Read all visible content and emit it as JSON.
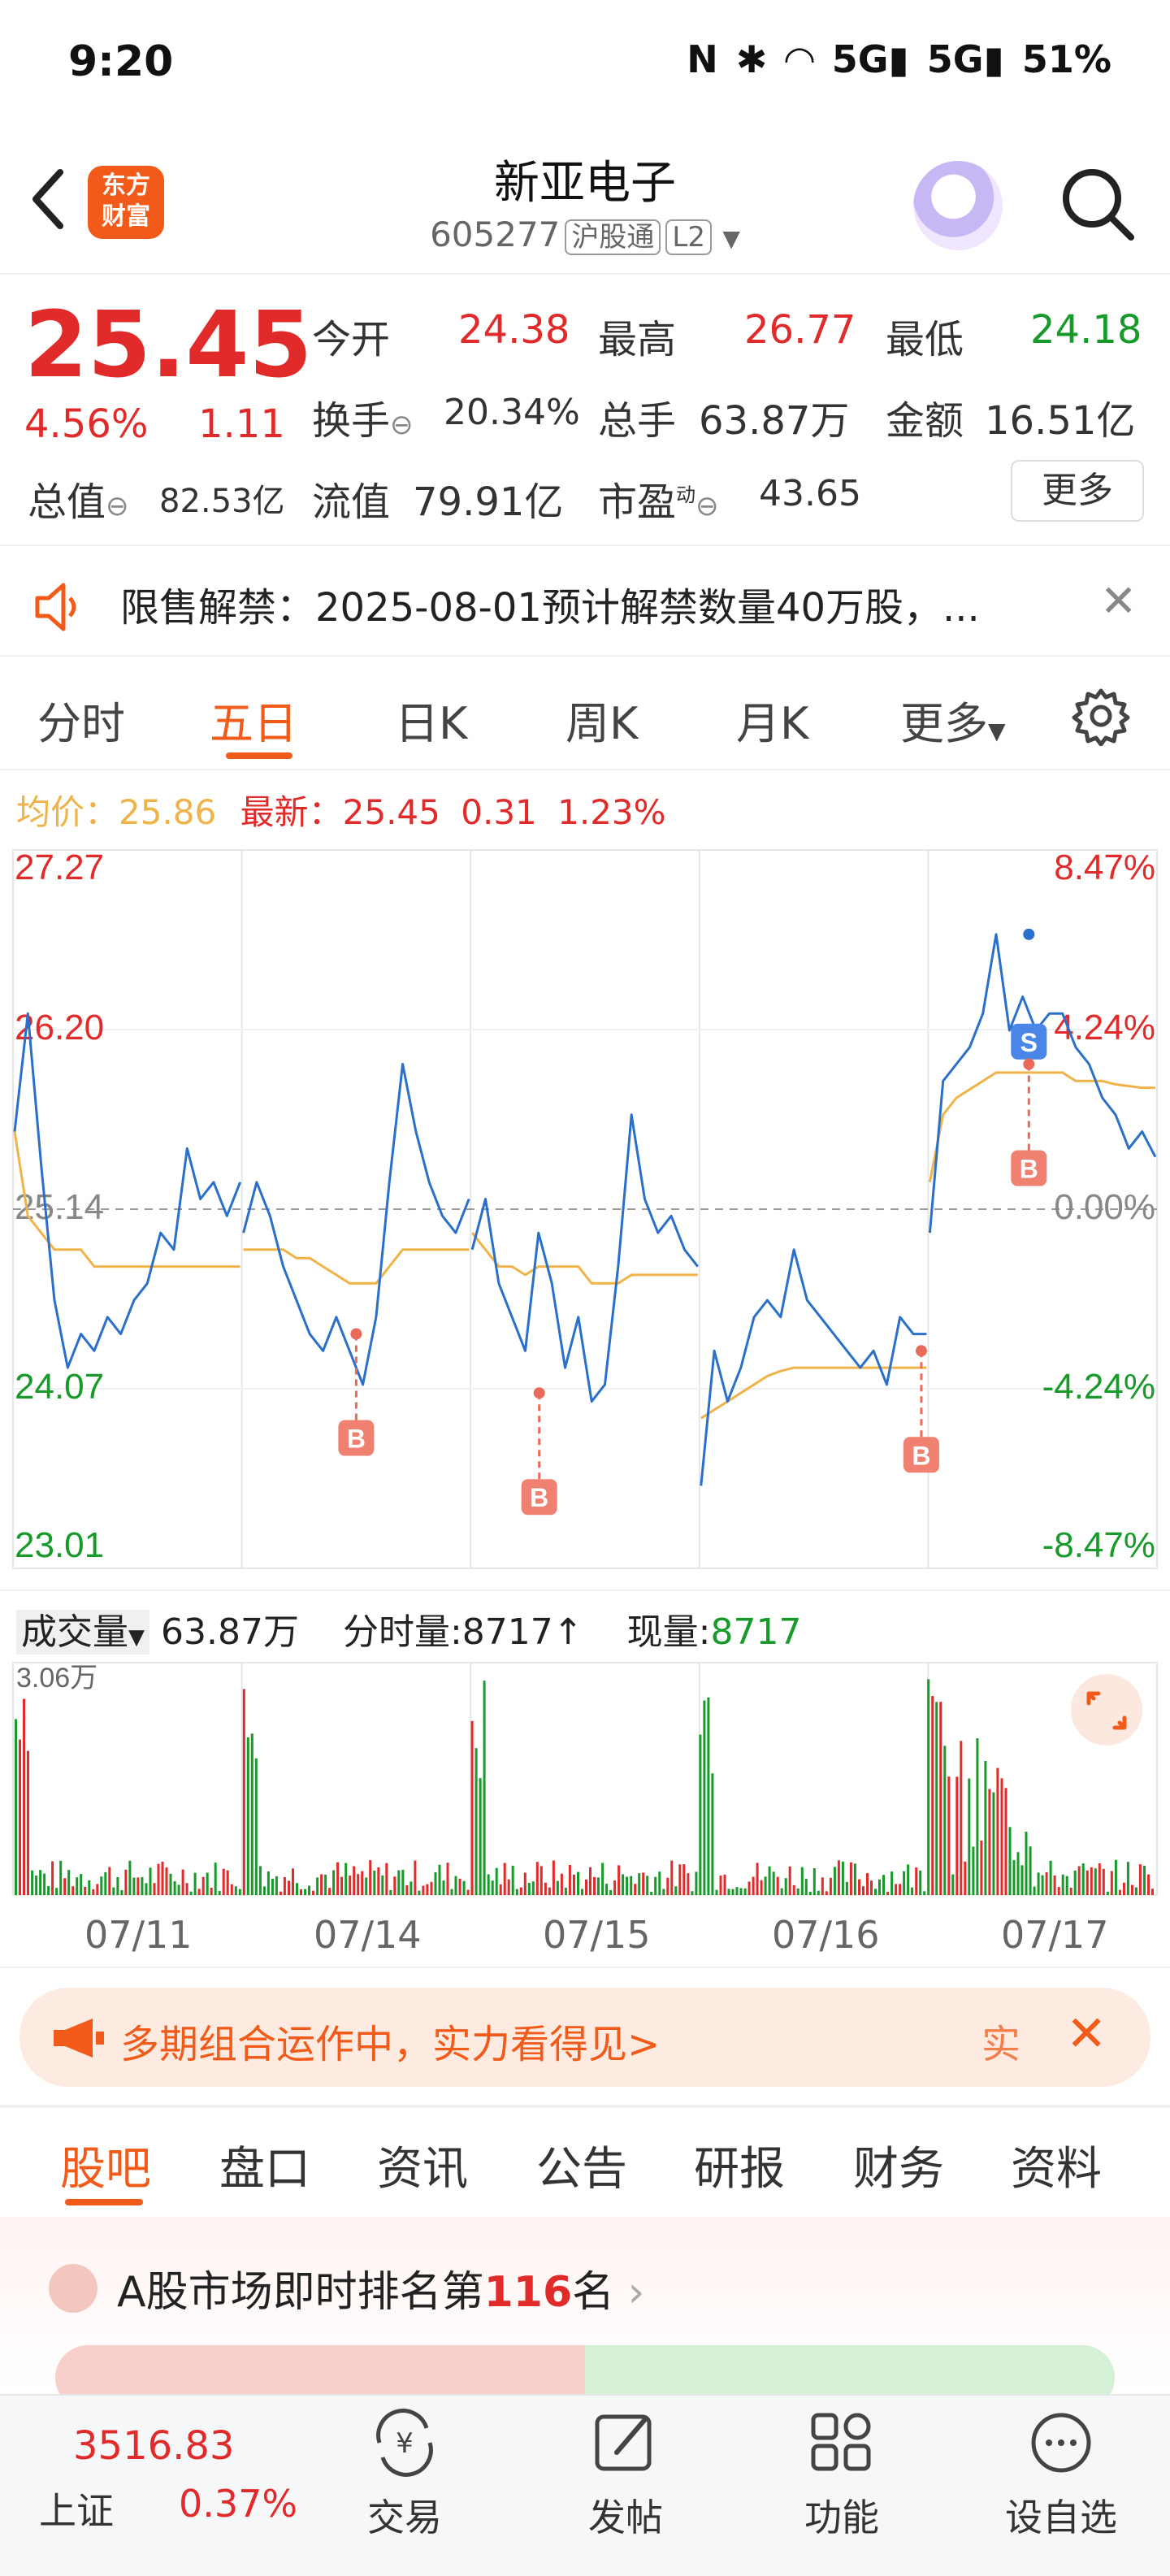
{
  "status": {
    "time": "9:20",
    "network": "5G",
    "network2": "5G",
    "battery": "51%"
  },
  "header": {
    "title": "新亚电子",
    "code": "605277",
    "market_tag": "沪股通",
    "level_tag": "L2",
    "logo_line1": "东方",
    "logo_line2": "财富"
  },
  "quote": {
    "price": "25.45",
    "change_pct": "4.56%",
    "change_abs": "1.11",
    "open_label": "今开",
    "open": "24.38",
    "high_label": "最高",
    "high": "26.77",
    "low_label": "最低",
    "low": "24.18",
    "turnover_label": "换手",
    "turnover": "20.34%",
    "volume_label": "总手",
    "volume": "63.87万",
    "amount_label": "金额",
    "amount": "16.51亿",
    "mktcap_label": "总值",
    "mktcap": "82.53亿",
    "float_label": "流值",
    "float_cap": "79.91亿",
    "pe_label": "市盈",
    "pe_sup": "动",
    "pe": "43.65",
    "more_label": "更多"
  },
  "notice": {
    "text": "限售解禁：2025-08-01预计解禁数量40万股，..."
  },
  "chart_tabs": [
    "分时",
    "五日",
    "日K",
    "周K",
    "月K",
    "更多"
  ],
  "chart_tabs_active": 1,
  "legend": {
    "avg_label": "均价：",
    "avg": "25.86",
    "latest_label": "最新：",
    "latest": "25.45",
    "latest_chg": "0.31",
    "latest_pct": "1.23%"
  },
  "volume_header": {
    "label": "成交量",
    "total": "63.87万",
    "tick_label": "分时量:",
    "tick_value": "8717",
    "tick_arrow": "↑",
    "now_label": "现量:",
    "now_value": "8717",
    "max_label": "3.06万"
  },
  "chart_data": {
    "type": "line",
    "title": "",
    "x": [
      "07/11",
      "07/14",
      "07/15",
      "07/16",
      "07/17"
    ],
    "y_labels_left": [
      "27.27",
      "26.20",
      "25.14",
      "24.07",
      "23.01"
    ],
    "y_labels_right": [
      "8.47%",
      "4.24%",
      "0.00%",
      "-4.24%",
      "-8.47%"
    ],
    "ylim": [
      23.01,
      27.27
    ],
    "prev_close": 25.14,
    "grid": true,
    "series": [
      {
        "values": [
          [
            25.6,
            26.3,
            25.4,
            24.6,
            24.2,
            24.4,
            24.3,
            24.5,
            24.4,
            24.6,
            24.7,
            25.0,
            24.9,
            25.5,
            25.2,
            25.3,
            25.1,
            25.3
          ],
          [
            25.0,
            25.3,
            25.1,
            24.8,
            24.6,
            24.4,
            24.3,
            24.5,
            24.3,
            24.1,
            24.5,
            25.3,
            26.0,
            25.6,
            25.3,
            25.1,
            25.0,
            25.2
          ],
          [
            24.9,
            25.2,
            24.7,
            24.5,
            24.3,
            25.0,
            24.7,
            24.2,
            24.5,
            24.0,
            24.1,
            24.8,
            25.7,
            25.2,
            25.0,
            25.1,
            24.9,
            24.8
          ],
          [
            23.5,
            24.3,
            24.0,
            24.2,
            24.5,
            24.6,
            24.5,
            24.9,
            24.6,
            24.5,
            24.4,
            24.3,
            24.2,
            24.3,
            24.1,
            24.5,
            24.4,
            24.4
          ],
          [
            25.0,
            25.9,
            26.0,
            26.1,
            26.3,
            26.77,
            26.2,
            26.4,
            26.2,
            26.3,
            26.3,
            26.1,
            26.0,
            25.8,
            25.7,
            25.5,
            25.6,
            25.45
          ]
        ]
      },
      {
        "values": [
          [
            25.6,
            25.1,
            25.0,
            24.9,
            24.9,
            24.9,
            24.8,
            24.8,
            24.8,
            24.8,
            24.8,
            24.8,
            24.8,
            24.8,
            24.8,
            24.8,
            24.8,
            24.8
          ],
          [
            24.9,
            24.9,
            24.9,
            24.9,
            24.85,
            24.85,
            24.8,
            24.75,
            24.7,
            24.7,
            24.7,
            24.8,
            24.9,
            24.9,
            24.9,
            24.9,
            24.9,
            24.9
          ],
          [
            25.0,
            24.9,
            24.8,
            24.8,
            24.75,
            24.8,
            24.8,
            24.8,
            24.8,
            24.7,
            24.7,
            24.7,
            24.75,
            24.75,
            24.75,
            24.75,
            24.75,
            24.75
          ],
          [
            23.9,
            23.95,
            24.0,
            24.05,
            24.1,
            24.15,
            24.18,
            24.2,
            24.2,
            24.2,
            24.2,
            24.2,
            24.2,
            24.2,
            24.2,
            24.2,
            24.2,
            24.2
          ],
          [
            25.3,
            25.7,
            25.8,
            25.85,
            25.9,
            25.95,
            25.95,
            25.95,
            25.95,
            25.95,
            25.95,
            25.9,
            25.9,
            25.9,
            25.88,
            25.87,
            25.86,
            25.86
          ]
        ]
      }
    ],
    "markers": [
      {
        "label": "B",
        "day": 1,
        "t": 0.5,
        "price": 24.4
      },
      {
        "label": "B",
        "day": 2,
        "t": 0.3,
        "price": 24.05
      },
      {
        "label": "B",
        "day": 3,
        "t": 0.97,
        "price": 24.3
      },
      {
        "label": "S",
        "day": 4,
        "t": 0.44,
        "price": 26.77
      },
      {
        "label": "B",
        "day": 4,
        "t": 0.44,
        "price": 26.0
      }
    ]
  },
  "bottom_banner": {
    "text": "多期组合运作中，实力看得见>",
    "right": "实"
  },
  "bottom_tabs": [
    "股吧",
    "盘口",
    "资讯",
    "公告",
    "研报",
    "财务",
    "资料"
  ],
  "rank": {
    "prefix": "A股市场即时排名第",
    "num": "116",
    "suffix": "名"
  },
  "bottom_nav": {
    "index_value": "3516.83",
    "index_name": "上证",
    "index_pct": "0.37%",
    "items": [
      "交易",
      "发帖",
      "功能",
      "设自选"
    ]
  },
  "colors": {
    "up": "#e12b2b",
    "down": "#179a2a",
    "accent": "#f25a1a",
    "price_line": "#2a6fc9",
    "avg_line": "#f0b34a"
  }
}
